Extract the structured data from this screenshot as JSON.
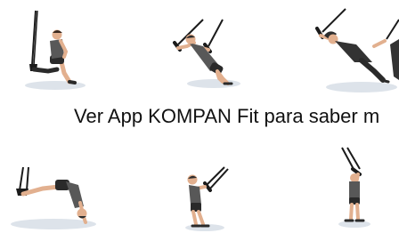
{
  "caption": {
    "text": "Ver App KOMPAN Fit para saber m"
  },
  "colors": {
    "background": "#ffffff",
    "text": "#111111",
    "skin": "#e2b08f",
    "shirt": "#585858",
    "shorts": "#2a2a2a",
    "strap": "#1b1b1b",
    "shadow": "#dde3ea"
  },
  "exercises": [
    {
      "pose": "suspension-lunge"
    },
    {
      "pose": "suspension-chest-press"
    },
    {
      "pose": "suspension-fly"
    },
    {
      "pose": "suspension-pike"
    },
    {
      "pose": "suspension-row"
    },
    {
      "pose": "suspension-standing-hold"
    }
  ]
}
